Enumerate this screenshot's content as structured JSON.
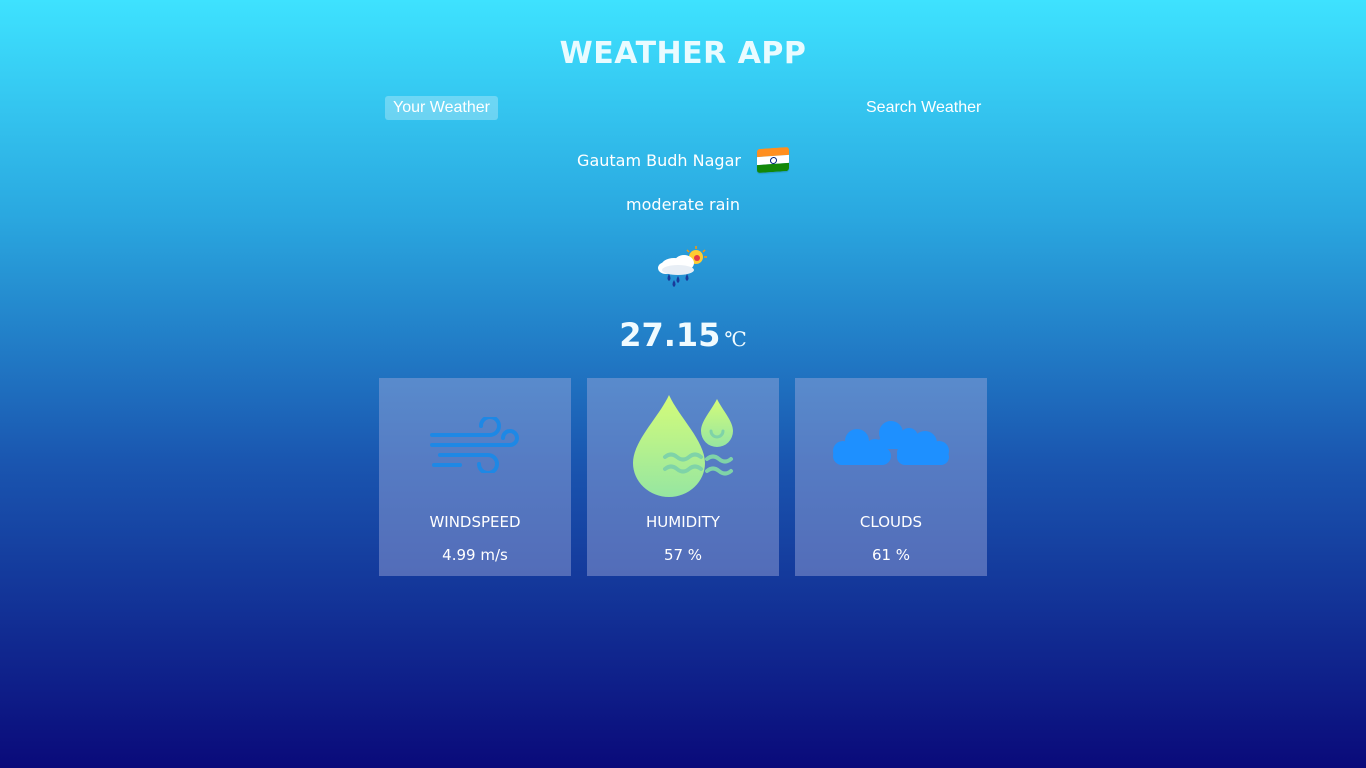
{
  "app": {
    "title": "WEATHER APP"
  },
  "tabs": {
    "your_weather": "Your Weather",
    "search_weather": "Search Weather",
    "active": "your_weather"
  },
  "location": {
    "city": "Gautam Budh Nagar",
    "country_flag_icon": "india-flag-icon"
  },
  "weather": {
    "description": "moderate rain",
    "icon": "rain-cloud-sun-icon",
    "temperature": "27.15",
    "unit": "℃"
  },
  "stats": [
    {
      "label": "WINDSPEED",
      "value": "4.99 m/s",
      "icon": "wind-icon"
    },
    {
      "label": "HUMIDITY",
      "value": "57 %",
      "icon": "humidity-drops-icon"
    },
    {
      "label": "CLOUDS",
      "value": "61 %",
      "icon": "clouds-icon"
    }
  ],
  "colors": {
    "gradient_top": "#3ee2ff",
    "gradient_bottom": "#0a0a7a",
    "card_bg": "rgba(160,170,220,0.45)",
    "wind_icon": "#1e88e5",
    "humidity_icon_start": "#d4fc79",
    "humidity_icon_end": "#96e6a1",
    "clouds_icon": "#1e90ff"
  }
}
